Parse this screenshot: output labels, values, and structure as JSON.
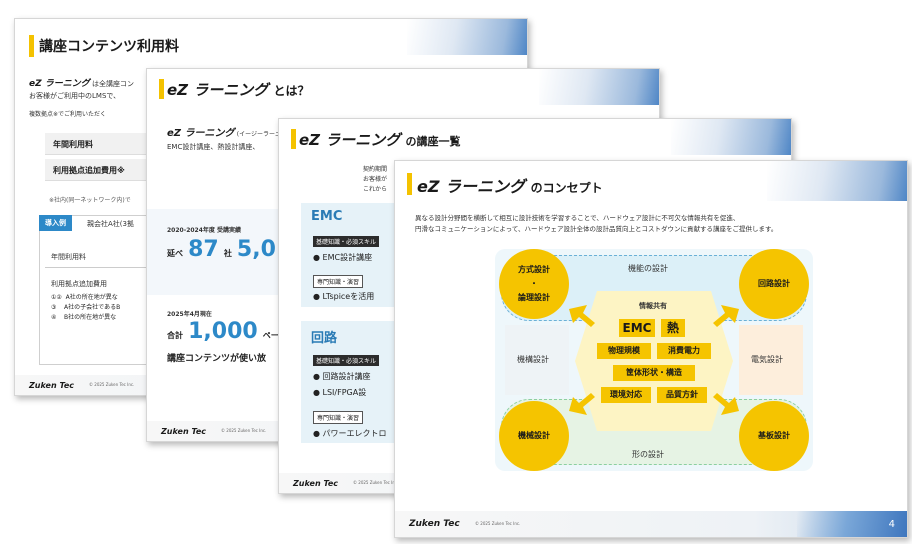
{
  "slide1": {
    "title": "講座コンテンツ利用料",
    "intro_brand": "eZ ラーニング",
    "intro_line1": "は全講座コン",
    "intro_line2": "お客様がご利用中のLMSで、",
    "intro_line3": "複数拠点※でご利用いただく",
    "row1": "年間利用料",
    "row2": "利用拠点追加費用※",
    "note": "※社内(同一ネットワーク内)で",
    "case_tag": "導入例",
    "case_text": "親会社A社(3拠",
    "case_row1": "年間利用料",
    "case_row2": "利用拠点追加費用",
    "list": [
      {
        "num": "①②",
        "text": "A社の所在地が異な"
      },
      {
        "num": "③",
        "text": "A社の子会社であるB"
      },
      {
        "num": "④",
        "text": "B社の所在地が異な"
      }
    ],
    "logo": "Zuken Tec",
    "copyright": "© 2025 Zuken Tec Inc."
  },
  "slide2": {
    "title_brand": "eZ ラーニング",
    "title_suffix": "とは？",
    "sub_brand": "eZ ラーニング",
    "sub_reading": "(イージーラーニ",
    "sub_line": "EMC設計講座、熱設計講座、",
    "stat1_label": "2020-2024年度 受講実績",
    "stat1_prefix": "延べ",
    "stat1_value": "87",
    "stat1_unit": "社",
    "stat1_value2": "5,0",
    "stat2_label": "2025年4月現在",
    "stat2_prefix": "合計",
    "stat2_value": "1,000",
    "stat2_unit": "ペー",
    "stat2_line": "講座コンテンツが使い放",
    "logo": "Zuken Tec",
    "copyright": "© 2025 Zuken Tec Inc."
  },
  "slide3": {
    "title_brand": "eZ ラーニング",
    "title_suffix": "の講座一覧",
    "side_text1": "契約期間",
    "side_text2": "お客様が",
    "side_text3": "これから",
    "emc": {
      "heading": "EMC",
      "tag1": "基礎知識・必須スキル",
      "item1": "● EMC設計講座",
      "tag2": "専門知識・演習",
      "item2": "● LTspiceを活用"
    },
    "circuit": {
      "heading": "回路",
      "tag1": "基礎知識・必須スキル",
      "item1": "● 回路設計講座",
      "item2": "● LSI/FPGA設",
      "tag2": "専門知識・演習",
      "item3": "● パワーエレクトロ"
    },
    "logo": "Zuken Tec",
    "copyright": "© 2025 Zuken Tec Inc."
  },
  "slide4": {
    "title_brand": "eZ ラーニング",
    "title_suffix": "のコンセプト",
    "desc1": "異なる設計分野間を横断して相互に設計技術を学習することで、ハードウェア設計に不可欠な情報共有を促進、",
    "desc2": "円滑なコミュニケーションによって、ハードウェア設計全体の設計品質向上とコストダウンに貢献する講座をご提供します。",
    "zone_top": "機能の設計",
    "zone_left": "機構設計",
    "zone_right": "電気設計",
    "zone_bottom": "形の設計",
    "circle_tl": [
      "方式設計",
      "・",
      "論理設計"
    ],
    "circle_tr": "回路設計",
    "circle_bl": "機械設計",
    "circle_br": "基板設計",
    "center_label": "情報共有",
    "chips": [
      "EMC",
      "熱",
      "物理規模",
      "消費電力",
      "筐体形状・構造",
      "環境対応",
      "品質方針"
    ],
    "logo": "Zuken Tec",
    "copyright": "© 2025 Zuken Tec Inc.",
    "page_number": "4"
  },
  "colors": {
    "accent_yellow": "#f5c400",
    "accent_blue": "#2d89c8",
    "stripe_blue": "#3e76be"
  }
}
